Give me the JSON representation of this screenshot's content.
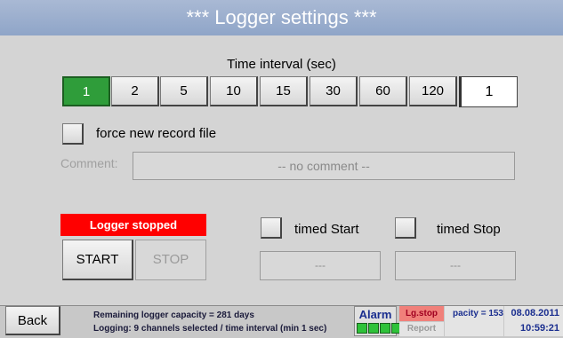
{
  "title": "***   Logger settings   ***",
  "interval": {
    "label": "Time interval (sec)",
    "options": [
      "1",
      "2",
      "5",
      "10",
      "15",
      "30",
      "60",
      "120"
    ],
    "selected_index": 0,
    "value": "1"
  },
  "force_new_record": {
    "label": "force new record file",
    "checked": false
  },
  "comment": {
    "label": "Comment:",
    "value": "-- no comment --"
  },
  "logger_status": "Logger stopped",
  "buttons": {
    "start": "START",
    "stop": "STOP",
    "back": "Back"
  },
  "timed_start": {
    "label": "timed Start",
    "value": "---"
  },
  "timed_stop": {
    "label": "timed Stop",
    "value": "---"
  },
  "footer": {
    "capacity_line": "Remaining logger capacity = 281 days",
    "logging_line": "Logging:  9 channels selected / time interval (min 1 sec)",
    "alarm": "Alarm",
    "lgstop": "Lg.stop",
    "report": "Report",
    "capacity_partial": "pacity = 153",
    "date": "08.08.2011",
    "time": "10:59:21"
  },
  "colors": {
    "active": "#2f9d3a",
    "status": "#ff0000",
    "title_bar": "#9aaecc"
  },
  "icons": {
    "checkbox": "checkbox-icon",
    "alarm_leds": "led-indicator-icon"
  }
}
